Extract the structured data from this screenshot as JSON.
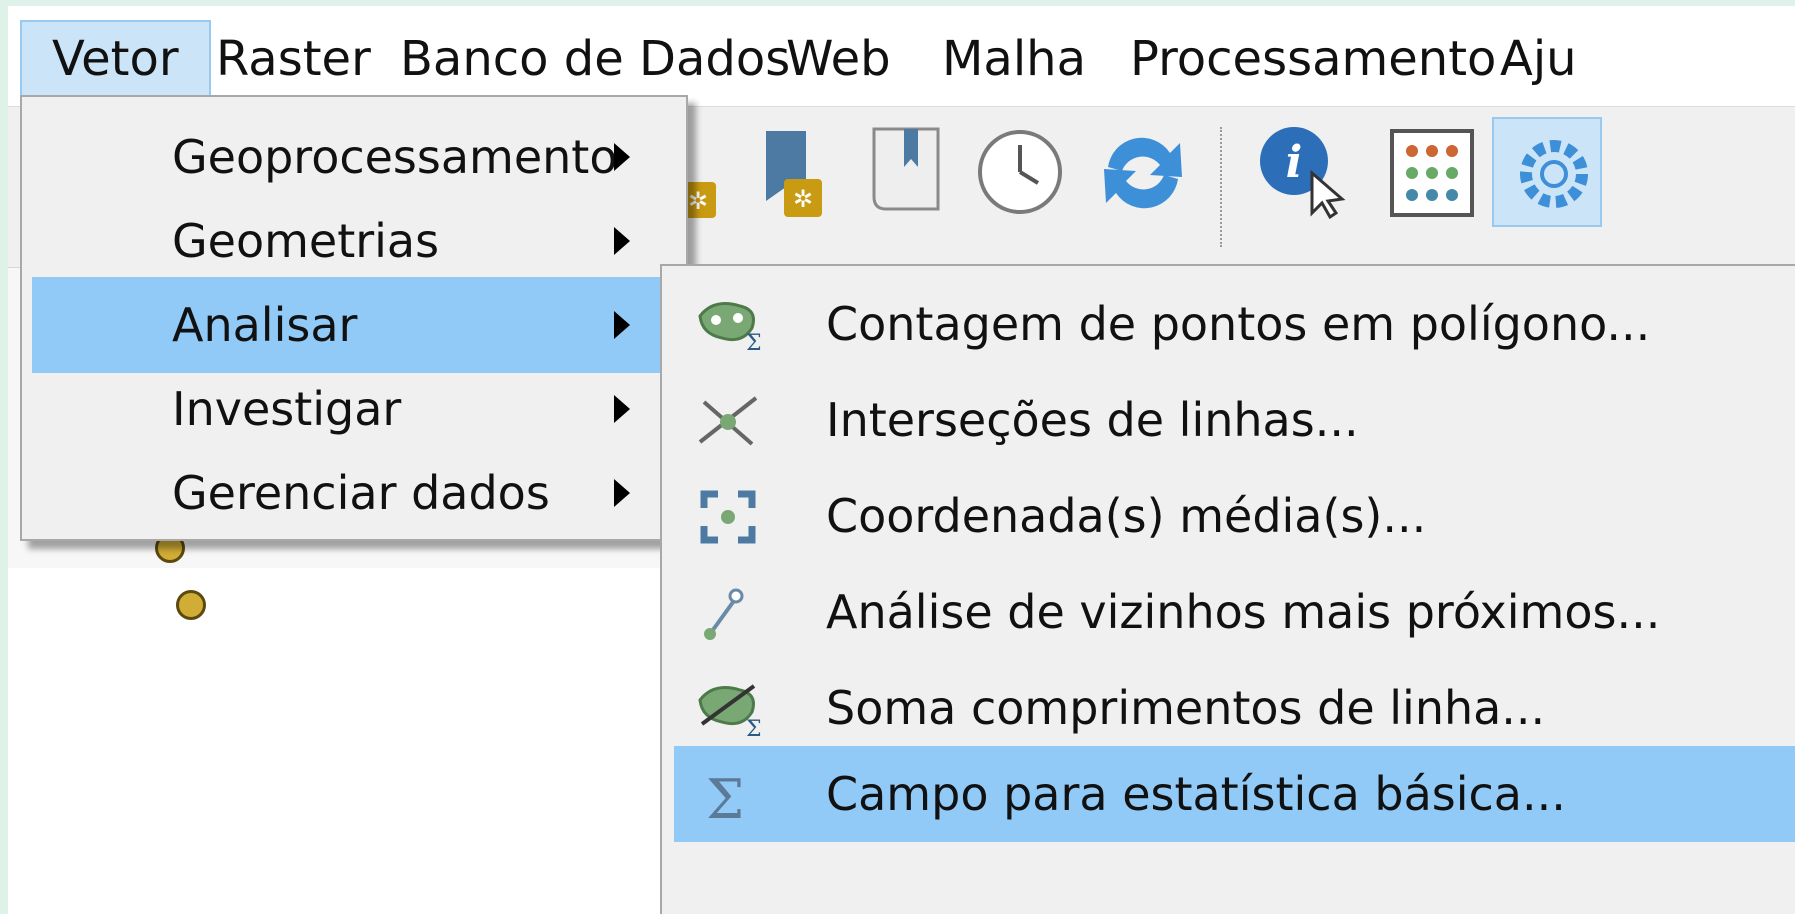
{
  "menubar": {
    "items": [
      "Vetor",
      "Raster",
      "Banco de Dados",
      "Web",
      "Malha",
      "Processamento",
      "Aju"
    ]
  },
  "vetor_menu": {
    "items": [
      {
        "label": "Geoprocessamento",
        "icon": "submenu-arrow"
      },
      {
        "label": "Geometrias",
        "icon": "submenu-arrow"
      },
      {
        "label": "Analisar",
        "icon": "submenu-arrow"
      },
      {
        "label": "Investigar",
        "icon": "submenu-arrow"
      },
      {
        "label": "Gerenciar dados",
        "icon": "submenu-arrow"
      }
    ],
    "highlighted": "Analisar"
  },
  "analisar_submenu": {
    "items": [
      {
        "label": "Contagem de pontos em polígono...",
        "icon": "count-points-icon"
      },
      {
        "label": "Interseções de linhas...",
        "icon": "line-intersections-icon"
      },
      {
        "label": "Coordenada(s) média(s)...",
        "icon": "mean-coordinates-icon"
      },
      {
        "label": "Análise de vizinhos mais próximos...",
        "icon": "nearest-neighbour-icon"
      },
      {
        "label": "Soma comprimentos de linha...",
        "icon": "sum-line-lengths-icon"
      },
      {
        "label": "Campo para estatística básica...",
        "icon": "sigma-icon"
      }
    ],
    "highlighted": "Campo para estatística básica..."
  },
  "toolbar": {
    "icons": [
      "new-layer-icon",
      "bookmark-add-icon",
      "bookmark-icon",
      "clock-icon",
      "refresh-icon",
      "identify-icon",
      "calculator-icon",
      "gear-icon"
    ]
  },
  "colors": {
    "highlight": "#91c9f7",
    "menu_active": "#cce4f7",
    "point_fill": "#d2ad35",
    "frame": "#dff2ea"
  }
}
